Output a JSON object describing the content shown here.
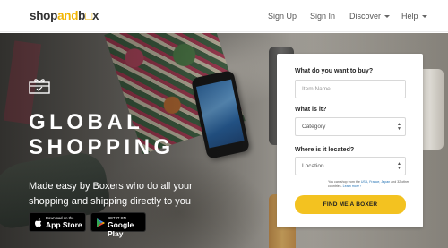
{
  "logo": {
    "part1": "shop",
    "part2": "and",
    "part3": "b",
    "part4": "x"
  },
  "nav": {
    "signup": "Sign Up",
    "signin": "Sign In",
    "discover": "Discover",
    "help": "Help"
  },
  "hero": {
    "headline_line1": "GLOBAL",
    "headline_line2": "SHOPPING",
    "sub_line1": "Made easy by Boxers who do all your",
    "sub_line2": "shopping and shipping directly to you",
    "app_store": {
      "small": "Download on the",
      "big": "App Store"
    },
    "google_play": {
      "small": "GET IT ON",
      "big": "Google Play"
    }
  },
  "form": {
    "q1_label": "What do you want to buy?",
    "q1_placeholder": "Item Name",
    "q2_label": "What is it?",
    "q2_value": "Category",
    "q3_label": "Where is it located?",
    "q3_value": "Location",
    "note_prefix": "You can shop from the ",
    "note_countries": "USA, France, Japan",
    "note_mid": " and 32 other countries. ",
    "note_link": "Learn more",
    "note_suffix": " ›",
    "cta": "FIND ME A BOXER"
  },
  "colors": {
    "accent": "#f3c220",
    "logo_accent": "#f2b705"
  }
}
